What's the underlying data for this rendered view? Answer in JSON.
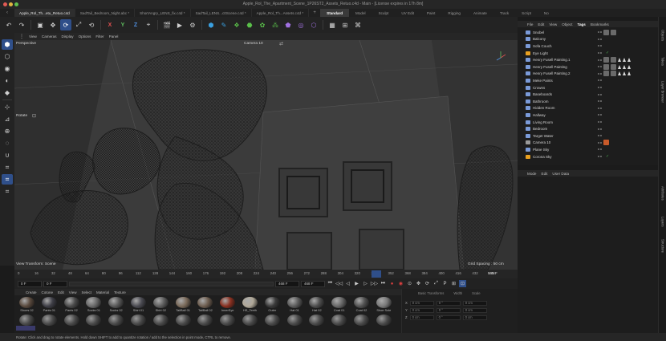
{
  "window": {
    "title": "Apple_Rol_The_Apartment_Scene_1P26ST2_Assets_Retuo.c4d - Main - [License expires in 17h 8m]"
  },
  "doc_tabs": [
    {
      "label": "Apple_Rol_Th...etu_Retuo.c4d",
      "active": true
    },
    {
      "label": "SadTail_Bedroom_Night.abc *",
      "active": false
    },
    {
      "label": "ShortAngry_LENS_fix.c4d *",
      "active": false
    },
    {
      "label": "SadTail_LENS...c0Scene.c4d *",
      "active": false
    },
    {
      "label": "Apple_Rol_Th...Assets.c4d *",
      "active": false
    }
  ],
  "layout_tabs": [
    {
      "label": "Standard",
      "active": true
    },
    {
      "label": "Model",
      "active": false
    },
    {
      "label": "Sculpt",
      "active": false
    },
    {
      "label": "UV Edit",
      "active": false
    },
    {
      "label": "Paint",
      "active": false
    },
    {
      "label": "Rigging",
      "active": false
    },
    {
      "label": "Animate",
      "active": false
    },
    {
      "label": "Track",
      "active": false
    },
    {
      "label": "Script",
      "active": false
    },
    {
      "label": "No",
      "active": false
    }
  ],
  "toolbar": {
    "undo": "↶",
    "redo": "↷",
    "x": "X",
    "y": "Y",
    "z": "Z"
  },
  "viewport": {
    "menu": [
      "View",
      "Cameras",
      "Display",
      "Options",
      "Filter",
      "Panel"
    ],
    "name": "Perspective",
    "camera": "Camera 10",
    "tool": "Rotate",
    "hint": "View Transform: Scene",
    "grid": "Grid Spacing : 50 cm"
  },
  "timeline": {
    "ticks": [
      "0",
      "16",
      "32",
      "48",
      "64",
      "80",
      "96",
      "112",
      "128",
      "144",
      "160",
      "176",
      "192",
      "208",
      "224",
      "240",
      "256",
      "272",
      "288",
      "304",
      "320",
      "336",
      "352",
      "368",
      "384",
      "400",
      "416",
      "432",
      "448"
    ],
    "current": "545 F"
  },
  "frames": {
    "start": "0 F",
    "current": "0 F",
    "end": "468 F",
    "end2": "468 F"
  },
  "material_menu": [
    "Create",
    "Cotone",
    "Edit",
    "View",
    "Select",
    "Material",
    "Texture"
  ],
  "materials": [
    {
      "name": "Shoes 02",
      "color": "#5a4a3e"
    },
    {
      "name": "Pants 01",
      "color": "#3e3e46"
    },
    {
      "name": "Pants 02",
      "color": "#4a4a4a"
    },
    {
      "name": "Socks 01",
      "color": "#6a6a6a"
    },
    {
      "name": "Socks 02",
      "color": "#585858"
    },
    {
      "name": "Shirt 01",
      "color": "#4b4b52"
    },
    {
      "name": "Shirt 02",
      "color": "#5e5e5e"
    },
    {
      "name": "TailBall 01",
      "color": "#7a6a5a"
    },
    {
      "name": "TailBall 02",
      "color": "#6e5e50"
    },
    {
      "name": "InnerEye",
      "color": "#8a3020"
    },
    {
      "name": "HS_Teeth",
      "color": "#b0a898"
    },
    {
      "name": "Outer",
      "color": "#3a3a3a"
    },
    {
      "name": "Hat 01",
      "color": "#5c5c5c"
    },
    {
      "name": "Hat 02",
      "color": "#4e4e4e"
    },
    {
      "name": "Coat 01",
      "color": "#686868"
    },
    {
      "name": "Coat 02",
      "color": "#525252"
    },
    {
      "name": "Shoe Sole",
      "color": "#7a7a7a"
    }
  ],
  "coords": {
    "header": [
      "Basic Transforms",
      "Width",
      "Scale"
    ],
    "rows": [
      {
        "axis": "X",
        "v1": "0 cm",
        "v2": "0 °",
        "v3": "0 cm"
      },
      {
        "axis": "Y",
        "v1": "0 cm",
        "v2": "0 °",
        "v3": "0 cm"
      },
      {
        "axis": "Z",
        "v1": "0 cm",
        "v2": "0 °",
        "v3": "0 cm"
      }
    ]
  },
  "status": "Rotate: Click and drag to rotate elements. Hold down SHIFT to add to quantize rotation / add to the selection in point mode, CTRL to remove.",
  "objects_menu": [
    "File",
    "Edit",
    "View",
    "Object",
    "Tags",
    "Bookmarks"
  ],
  "objects": [
    {
      "name": "Snobel",
      "color": "#7a9ad8",
      "tags": "thumbs"
    },
    {
      "name": "Balcony",
      "color": "#7a9ad8",
      "tags": ""
    },
    {
      "name": "Sofa Couch",
      "color": "#7a9ad8",
      "tags": ""
    },
    {
      "name": "Eye Light",
      "color": "#e8a020",
      "tags": "check"
    },
    {
      "name": "Henry Fusell Painting.1",
      "color": "#7a9ad8",
      "tags": "tris"
    },
    {
      "name": "Henry Fusell Painting",
      "color": "#7a9ad8",
      "tags": "tris"
    },
    {
      "name": "Henry Fusell Painting.2",
      "color": "#7a9ad8",
      "tags": "tris"
    },
    {
      "name": "Meke Paints",
      "color": "#7a9ad8",
      "tags": ""
    },
    {
      "name": "Crowns",
      "color": "#7a9ad8",
      "tags": ""
    },
    {
      "name": "Baseboards",
      "color": "#7a9ad8",
      "tags": ""
    },
    {
      "name": "Bathroom",
      "color": "#7a9ad8",
      "tags": ""
    },
    {
      "name": "Hidden Room",
      "color": "#7a9ad8",
      "tags": ""
    },
    {
      "name": "Hallway",
      "color": "#7a9ad8",
      "tags": ""
    },
    {
      "name": "Living Room",
      "color": "#7a9ad8",
      "tags": ""
    },
    {
      "name": "Bedroom",
      "color": "#7a9ad8",
      "tags": ""
    },
    {
      "name": "Target Water",
      "color": "#7a9ad8",
      "tags": ""
    },
    {
      "name": "Camera 10",
      "color": "#9a9a9a",
      "tags": "cam"
    },
    {
      "name": "Plane Sky",
      "color": "#7a9ad8",
      "tags": ""
    },
    {
      "name": "Corona Sky",
      "color": "#e8a020",
      "tags": "check"
    }
  ],
  "attr_menu": [
    "Mode",
    "Edit",
    "User Data"
  ],
  "side_tabs": [
    "Objects",
    "Takes",
    "Layer Browser",
    "Attributes",
    "Layers",
    "Structure"
  ]
}
